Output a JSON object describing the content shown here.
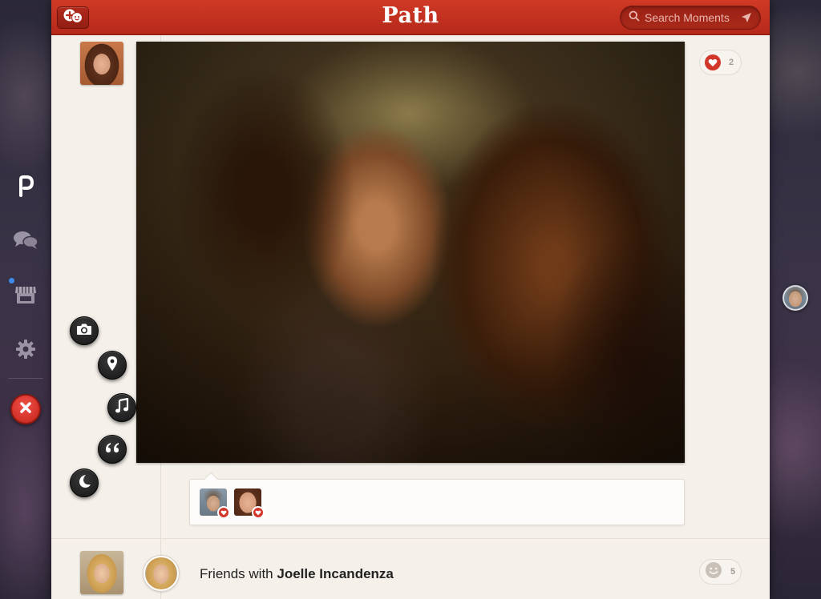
{
  "app": {
    "title": "Path"
  },
  "topbar": {
    "compose_icon": "add-friend-icon",
    "search": {
      "placeholder": "Search Moments",
      "value": "",
      "icon": "search-icon",
      "action_icon": "send-arrow-icon"
    }
  },
  "dock": {
    "items": [
      {
        "name": "path",
        "icon": "path-logo-icon",
        "active": true
      },
      {
        "name": "messages",
        "icon": "chat-bubbles-icon",
        "active": false
      },
      {
        "name": "shop",
        "icon": "shop-icon",
        "active": false,
        "notification": true
      },
      {
        "name": "settings",
        "icon": "gear-icon",
        "active": false
      }
    ],
    "close_icon": "close-icon"
  },
  "compose_menu": [
    {
      "name": "camera",
      "icon": "camera-icon"
    },
    {
      "name": "location",
      "icon": "location-pin-icon"
    },
    {
      "name": "music",
      "icon": "music-note-icon"
    },
    {
      "name": "thought",
      "icon": "quote-icon"
    },
    {
      "name": "sleep",
      "icon": "moon-icon"
    }
  ],
  "moments": [
    {
      "type": "photo",
      "likes": {
        "count": "2",
        "icon": "heart-icon"
      },
      "likers": [
        "man",
        "woman"
      ]
    },
    {
      "type": "friendship",
      "text_prefix": "Friends with ",
      "friend_name": "Joelle Incandenza",
      "reactions": {
        "count": "5",
        "icon": "smiley-icon"
      }
    }
  ],
  "colors": {
    "brand_red": "#c8321f",
    "heart_red": "#d2362a",
    "panel_bg": "#f5f0ea",
    "notification_blue": "#3d8bea"
  }
}
